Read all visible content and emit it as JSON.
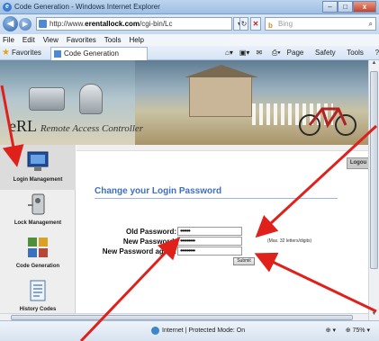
{
  "window": {
    "title": "Code Generation - Windows Internet Explorer",
    "minimize": "–",
    "maximize": "□",
    "close": "x"
  },
  "address": {
    "url_prefix": "http://www.",
    "url_domain": "erentallock.com",
    "url_suffix": "/cgi-bin/Lc",
    "search_placeholder": "Bing"
  },
  "menu": [
    "File",
    "Edit",
    "View",
    "Favorites",
    "Tools",
    "Help"
  ],
  "favorites": {
    "label": "Favorites",
    "tab_label": "Code Generation",
    "commands": [
      "Page ▾",
      "Safety ▾",
      "Tools ▾"
    ]
  },
  "site": {
    "logo": "eRL",
    "tagline": "Remote Access Controller",
    "logout": "Logou",
    "nav": [
      {
        "label": "Login Management"
      },
      {
        "label": "Lock Management"
      },
      {
        "label": "Code Generation"
      },
      {
        "label": "History Codes"
      }
    ],
    "page_title": "Change your Login Password",
    "form": {
      "old_label": "Old Password:",
      "old_value": "••••••",
      "new_label": "New Password:",
      "new_value": "•••••••••",
      "hint": "(Max. 32 letters/digits)",
      "again_label": "New Password again:",
      "again_value": "•••••••••",
      "submit": "Submit"
    }
  },
  "status": {
    "zone": "Internet | Protected Mode: On",
    "zoom": "75%"
  },
  "colors": {
    "accent": "#3d6fc2",
    "annotation_arrows": "#e0201b"
  }
}
